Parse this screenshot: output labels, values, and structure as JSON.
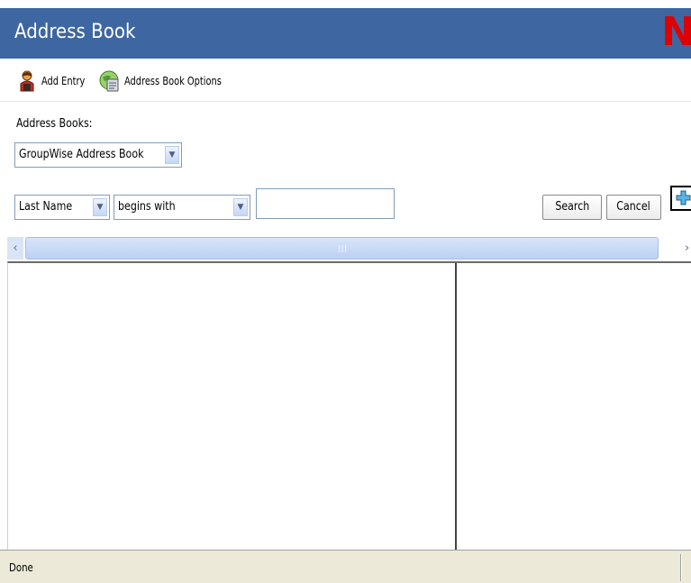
{
  "window": {
    "title": "Address Book",
    "logo": "N",
    "accent_color": "#3e66a0",
    "logo_color": "#e00000"
  },
  "toolbar": {
    "add_entry": {
      "label": "Add Entry",
      "icon": "person-icon"
    },
    "options": {
      "label": "Address Book Options",
      "icon": "address-book-options-icon"
    }
  },
  "address_books": {
    "label": "Address Books:",
    "selected": "GroupWise Address Book"
  },
  "search": {
    "field_selected": "Last Name",
    "operator_selected": "begins with",
    "query_value": "",
    "search_label": "Search",
    "cancel_label": "Cancel",
    "add_row_icon": "plus-icon"
  },
  "status": {
    "text": "Done"
  }
}
